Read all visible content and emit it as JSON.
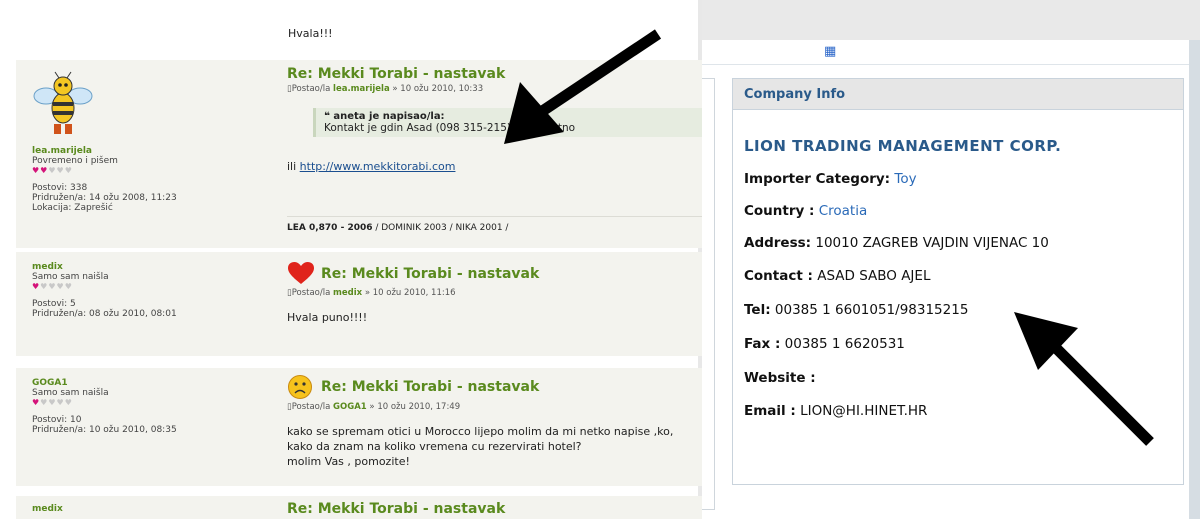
{
  "forum": {
    "top_post_text": "Hvala!!!",
    "posts": [
      {
        "username": "lea.marijela",
        "rank": "Povremeno i pišem",
        "hearts_on": 2,
        "hearts_total": 5,
        "stats": [
          "Postovi: 338",
          "Pridružen/a: 14 ožu 2008, 11:23",
          "Lokacija: Zaprešić"
        ],
        "title": "Re: Mekki Torabi - nastavak",
        "meta_prefix": "Postao/la",
        "meta_user": "lea.marijela",
        "meta_date": "» 10 ožu 2010, 10:33",
        "quote_header": "aneta je napisao/la:",
        "quote_text": "Kontakt je gdin Asad (098 315-215) Poz i sretno",
        "text_prefix": "ili ",
        "link": "http://www.mekkitorabi.com",
        "signature_bold": "LEA 0,870 - 2006",
        "signature_rest": " / DOMINIK 2003 / NIKA 2001 /"
      },
      {
        "username": "medix",
        "rank": "Samo sam naišla",
        "hearts_on": 1,
        "hearts_total": 5,
        "stats": [
          "Postovi: 5",
          "Pridružen/a: 08 ožu 2010, 08:01"
        ],
        "title": "Re: Mekki Torabi - nastavak",
        "meta_prefix": "Postao/la",
        "meta_user": "medix",
        "meta_date": "» 10 ožu 2010, 11:16",
        "text": "Hvala puno!!!!"
      },
      {
        "username": "GOGA1",
        "rank": "Samo sam naišla",
        "hearts_on": 1,
        "hearts_total": 5,
        "stats": [
          "Postovi: 10",
          "Pridružen/a: 10 ožu 2010, 08:35"
        ],
        "title": "Re: Mekki Torabi - nastavak",
        "meta_prefix": "Postao/la",
        "meta_user": "GOGA1",
        "meta_date": "» 10 ožu 2010, 17:49",
        "text_lines": [
          "kako se spremam otici u Morocco lijepo molim da mi netko napise ,ko,",
          "kako da znam na koliko vremena cu rezervirati hotel?",
          "molim Vas , pomozite!"
        ]
      },
      {
        "username": "medix",
        "title": "Re: Mekki Torabi - nastavak"
      }
    ]
  },
  "company_panel": {
    "header": "Company Info",
    "company_name": "LION TRADING MANAGEMENT CORP.",
    "importer_category_label": "Importer Category:",
    "importer_category_value": "Toy",
    "country_label": "Country :",
    "country_value": "Croatia",
    "address_label": "Address:",
    "address_value": "10010 ZAGREB VAJDIN VIJENAC 10",
    "contact_label": "Contact :",
    "contact_value": "ASAD SABO AJEL",
    "tel_label": "Tel:",
    "tel_value": "00385 1 6601051/98315215",
    "fax_label": "Fax :",
    "fax_value": "00385 1 6620531",
    "website_label": "Website :",
    "email_label": "Email :",
    "email_value": "LION@HI.HINET.HR"
  },
  "icons": {
    "smiley_heart": "heart-icon",
    "smiley_sad": "sad-face-icon",
    "post_icon": "document-icon",
    "quote_icon": "quote-icon",
    "logo": "logo-icon"
  },
  "colors": {
    "forum_green": "#5a8a1e",
    "panel_blue": "#2a5a8a",
    "link_blue": "#2a6ab8",
    "heart_pink": "#d4147a"
  }
}
